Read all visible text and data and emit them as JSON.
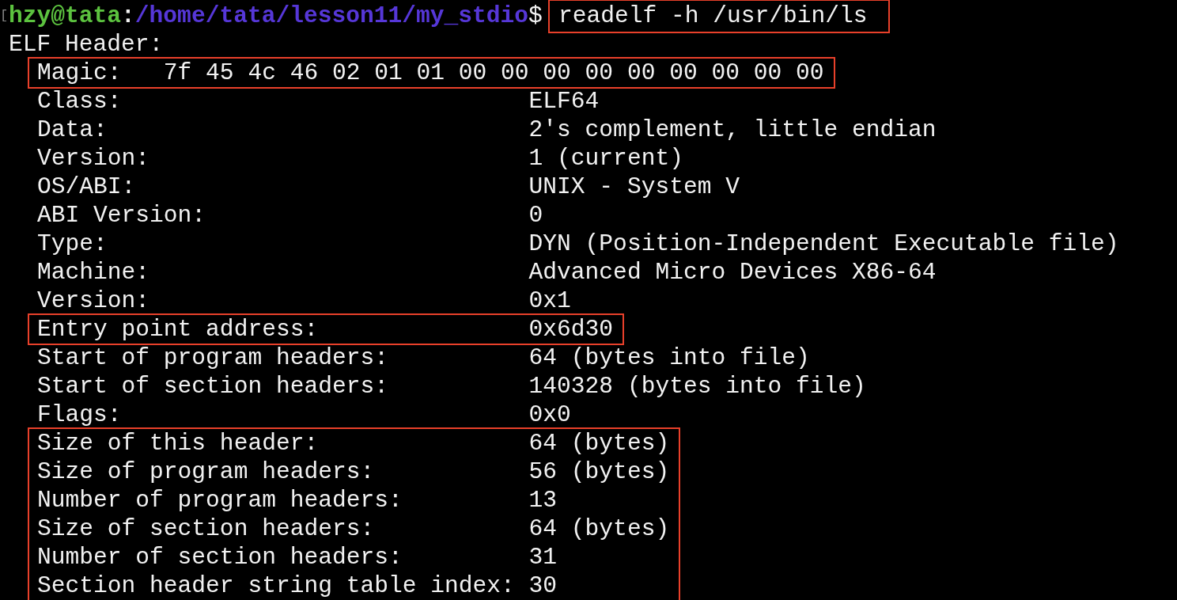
{
  "prompt": {
    "bracket": "[",
    "user_host": "hzy@tata",
    "separator": ":",
    "path": "/home/tata/lesson11/my_stdio",
    "symbol": "$"
  },
  "command": {
    "text": "readelf -h /usr/bin/ls",
    "highlighted": true
  },
  "output": {
    "title": "ELF Header:",
    "groups": [
      {
        "highlighted": true,
        "fields": [
          {
            "kind": "magic",
            "label": "Magic:",
            "value": "7f 45 4c 46 02 01 01 00 00 00 00 00 00 00 00 00"
          }
        ]
      },
      {
        "highlighted": false,
        "fields": [
          {
            "kind": "field",
            "label": "Class:",
            "value": "ELF64"
          },
          {
            "kind": "field",
            "label": "Data:",
            "value": "2's complement, little endian"
          },
          {
            "kind": "field",
            "label": "Version:",
            "value": "1 (current)"
          },
          {
            "kind": "field",
            "label": "OS/ABI:",
            "value": "UNIX - System V"
          },
          {
            "kind": "field",
            "label": "ABI Version:",
            "value": "0"
          },
          {
            "kind": "field",
            "label": "Type:",
            "value": "DYN (Position-Independent Executable file)"
          },
          {
            "kind": "field",
            "label": "Machine:",
            "value": "Advanced Micro Devices X86-64"
          },
          {
            "kind": "field",
            "label": "Version:",
            "value": "0x1"
          }
        ]
      },
      {
        "highlighted": true,
        "fields": [
          {
            "kind": "field",
            "label": "Entry point address:",
            "value": "0x6d30"
          }
        ]
      },
      {
        "highlighted": false,
        "fields": [
          {
            "kind": "field",
            "label": "Start of program headers:",
            "value": "64 (bytes into file)"
          },
          {
            "kind": "field",
            "label": "Start of section headers:",
            "value": "140328 (bytes into file)"
          },
          {
            "kind": "field",
            "label": "Flags:",
            "value": "0x0"
          }
        ]
      },
      {
        "highlighted": true,
        "fields": [
          {
            "kind": "field",
            "label": "Size of this header:",
            "value": "64 (bytes)"
          },
          {
            "kind": "field",
            "label": "Size of program headers:",
            "value": "56 (bytes)"
          },
          {
            "kind": "field",
            "label": "Number of program headers:",
            "value": "13"
          },
          {
            "kind": "field",
            "label": "Size of section headers:",
            "value": "64 (bytes)"
          },
          {
            "kind": "field",
            "label": "Number of section headers:",
            "value": "31"
          },
          {
            "kind": "field",
            "label": "Section header string table index:",
            "value": "30"
          }
        ]
      }
    ]
  }
}
